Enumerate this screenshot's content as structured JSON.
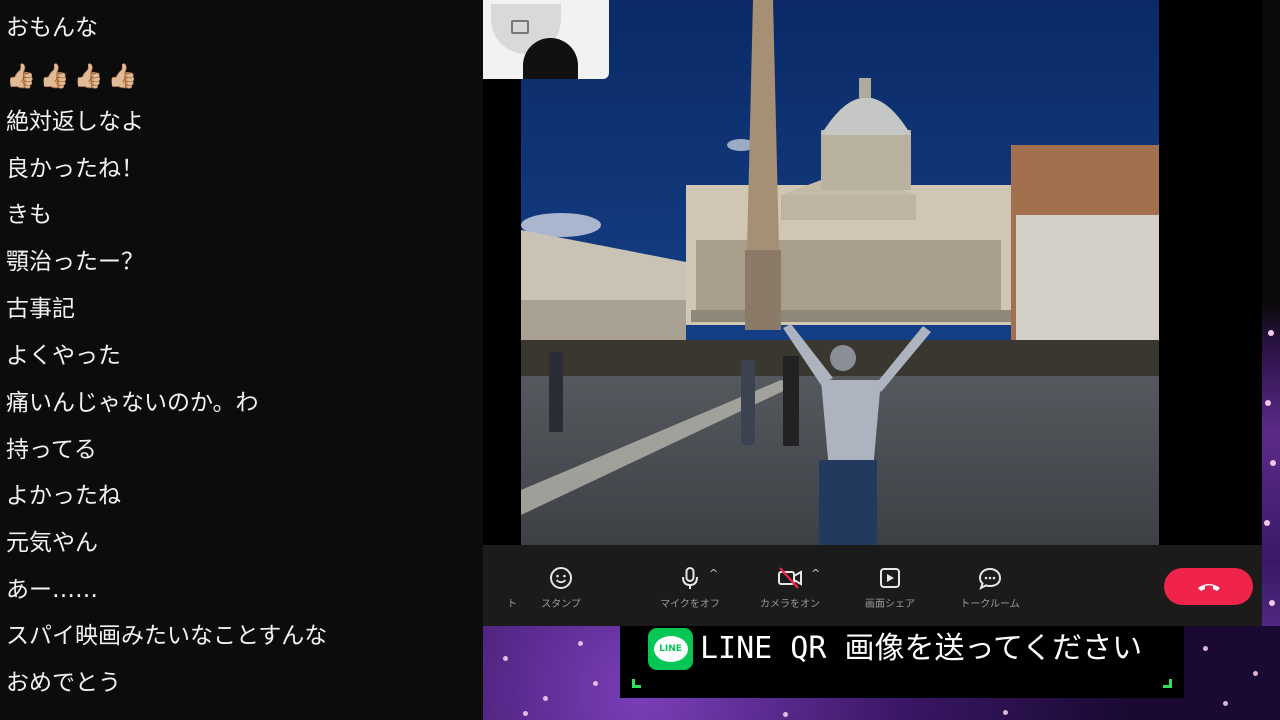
{
  "chat": {
    "comments": [
      {
        "text": "おもんな"
      },
      {
        "text": "👍🏼👍🏼👍🏼👍🏼"
      },
      {
        "text": "絶対返しなよ"
      },
      {
        "text": "良かったね！"
      },
      {
        "text": "きも"
      },
      {
        "text": "顎治ったー？"
      },
      {
        "text": "古事記"
      },
      {
        "text": "よくやった"
      },
      {
        "text": "痛いんじゃないのか。わ"
      },
      {
        "text": "持ってる"
      },
      {
        "text": "よかったね"
      },
      {
        "text": "元気やん"
      },
      {
        "text": "あー……"
      },
      {
        "text": "スパイ映画みたいなことすんな"
      },
      {
        "text": "おめでとう"
      }
    ]
  },
  "call": {
    "controls": {
      "partial_label": "ト",
      "stamp_label": "スタンプ",
      "mic_label": "マイクをオフ",
      "camera_label": "カメラをオン",
      "screen_share_label": "画面シェア",
      "talk_room_label": "トークルーム"
    }
  },
  "banner": {
    "logo_text": "LINE",
    "text": "LINE QR 画像を送ってください"
  },
  "colors": {
    "hangup": "#f0244b",
    "line_green": "#06c755",
    "chat_bg": "#0c0c0c",
    "control_bar_bg": "#1b1b1b"
  },
  "icons": [
    "smile-icon",
    "microphone-icon",
    "camera-off-icon",
    "screen-share-icon",
    "chat-bubble-icon",
    "hangup-phone-icon"
  ]
}
